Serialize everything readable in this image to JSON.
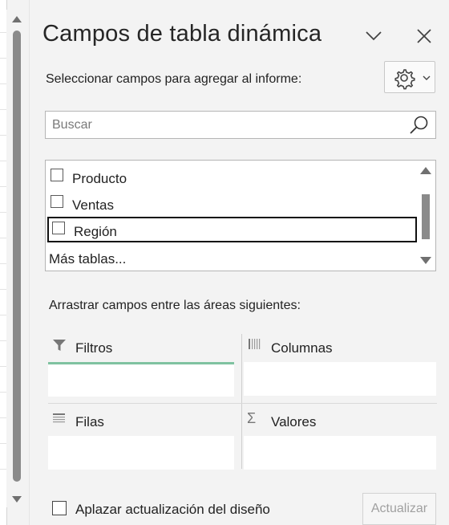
{
  "pane": {
    "title": "Campos de tabla dinámica",
    "subtitle": "Seleccionar campos para agregar al informe:",
    "icons": {
      "collapse": "chevron-down-icon",
      "close": "close-icon",
      "settings": "gear-icon",
      "search": "search-icon"
    }
  },
  "search": {
    "placeholder": "Buscar",
    "value": ""
  },
  "fields": [
    {
      "label": "Producto",
      "checked": false
    },
    {
      "label": "Ventas",
      "checked": false
    },
    {
      "label": "Región",
      "checked": false,
      "focused": true
    }
  ],
  "more_tables": "Más tablas...",
  "areas_label": "Arrastrar campos entre las áreas siguientes:",
  "areas": {
    "filters": {
      "label": "Filtros",
      "icon": "filter-icon"
    },
    "columns": {
      "label": "Columnas",
      "icon": "columns-icon"
    },
    "rows": {
      "label": "Filas",
      "icon": "rows-icon"
    },
    "values": {
      "label": "Valores",
      "icon": "sigma-icon"
    }
  },
  "footer": {
    "defer_label": "Aplazar actualización del diseño",
    "defer_checked": false,
    "update_label": "Actualizar",
    "update_enabled": false
  },
  "colors": {
    "pane_bg": "#f3f3f3",
    "filters_accent": "#7fc2a0",
    "disabled_text": "#a0a0a0"
  }
}
